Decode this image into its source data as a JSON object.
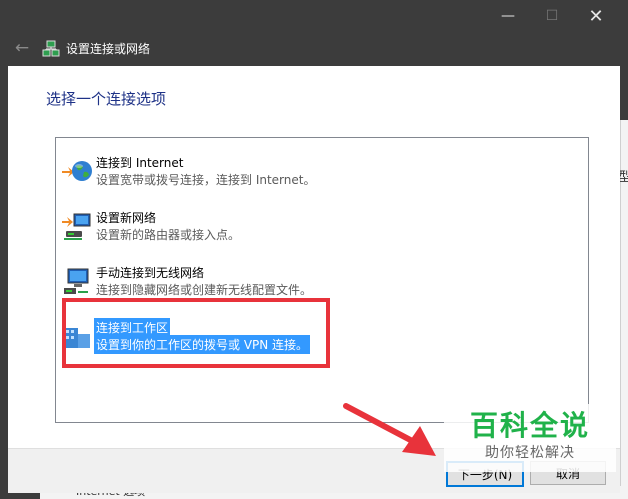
{
  "window": {
    "title": "设置连接或网络",
    "minimize": "—",
    "maximize": "☐",
    "close": "✕",
    "back": "←"
  },
  "main": {
    "heading": "选择一个连接选项",
    "options": [
      {
        "title": "连接到 Internet",
        "desc": "设置宽带或拨号连接，连接到 Internet。",
        "icon": "globe-icon",
        "selected": false
      },
      {
        "title": "设置新网络",
        "desc": "设置新的路由器或接入点。",
        "icon": "router-icon",
        "selected": false
      },
      {
        "title": "手动连接到无线网络",
        "desc": "连接到隐藏网络或创建新无线配置文件。",
        "icon": "wireless-icon",
        "selected": false
      },
      {
        "title": "连接到工作区",
        "desc": "设置到你的工作区的拨号或 VPN 连接。",
        "icon": "workplace-icon",
        "selected": true
      }
    ]
  },
  "footer": {
    "next_label": "下一步(N)",
    "cancel_label": "取消"
  },
  "background": {
    "right_text": "型",
    "bottom_text": "Internet 选项"
  },
  "watermark": {
    "main": "百科全说",
    "sub": "助你轻松解决"
  },
  "colors": {
    "heading": "#1e3287",
    "selection": "#3399ff",
    "highlight_box": "#e8333b",
    "watermark_green": "#20b24a"
  }
}
